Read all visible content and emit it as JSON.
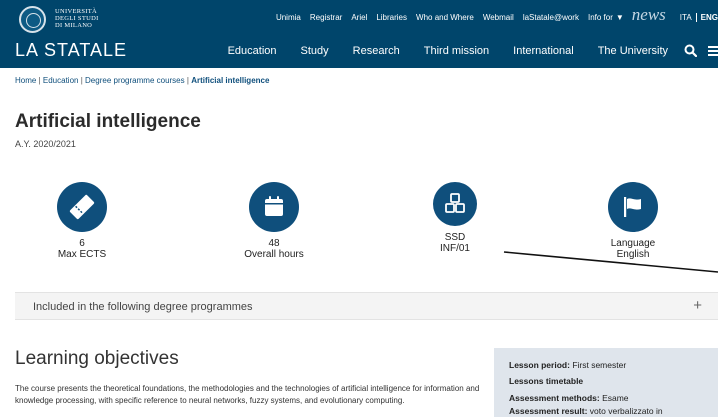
{
  "header": {
    "university": [
      "UNIVERSITÀ",
      "DEGLI STUDI",
      "DI MILANO"
    ],
    "brand": "LA STATALE",
    "utility_links": [
      "Unimia",
      "Registrar",
      "Ariel",
      "Libraries",
      "Who and Where",
      "Webmail",
      "laStatale@work",
      "Info for"
    ],
    "news": "news",
    "lang_it": "ITA",
    "lang_en": "ENG",
    "nav": [
      "Education",
      "Study",
      "Research",
      "Third mission",
      "International",
      "The University"
    ]
  },
  "breadcrumb": {
    "items": [
      "Home",
      "Education",
      "Degree programme courses"
    ],
    "separator": "|",
    "current": "Artificial intelligence"
  },
  "course": {
    "title": "Artificial intelligence",
    "year": "A.Y. 2020/2021"
  },
  "stats": [
    {
      "icon": "ticket-icon",
      "value": "6",
      "label": "Max ECTS"
    },
    {
      "icon": "calendar-icon",
      "value": "48",
      "label": "Overall hours"
    },
    {
      "icon": "cubes-icon",
      "value": "SSD",
      "label": "INF/01"
    },
    {
      "icon": "flag-icon",
      "value": "Language",
      "label": "English"
    }
  ],
  "degree_programmes": {
    "label": "Included in the following degree programmes",
    "toggle": "+"
  },
  "learning_objectives": {
    "title": "Learning objectives",
    "text": "The course presents the theoretical foundations, the methodologies and the technologies of artificial intelligence for information and knowledge processing, with specific reference to neural networks, fuzzy systems, and evolutionary computing."
  },
  "sidebar": {
    "lesson_period_label": "Lesson period:",
    "lesson_period_value": "First semester",
    "timetable_link": "Lessons timetable",
    "assessment_methods_label": "Assessment methods:",
    "assessment_methods_value": "Esame",
    "assessment_result_label": "Assessment result:",
    "assessment_result_value": "voto verbalizzato in"
  },
  "colors": {
    "header_bg": "#00456b",
    "accent": "#0f4f7c",
    "sidebar_bg": "#dfe5ec"
  }
}
